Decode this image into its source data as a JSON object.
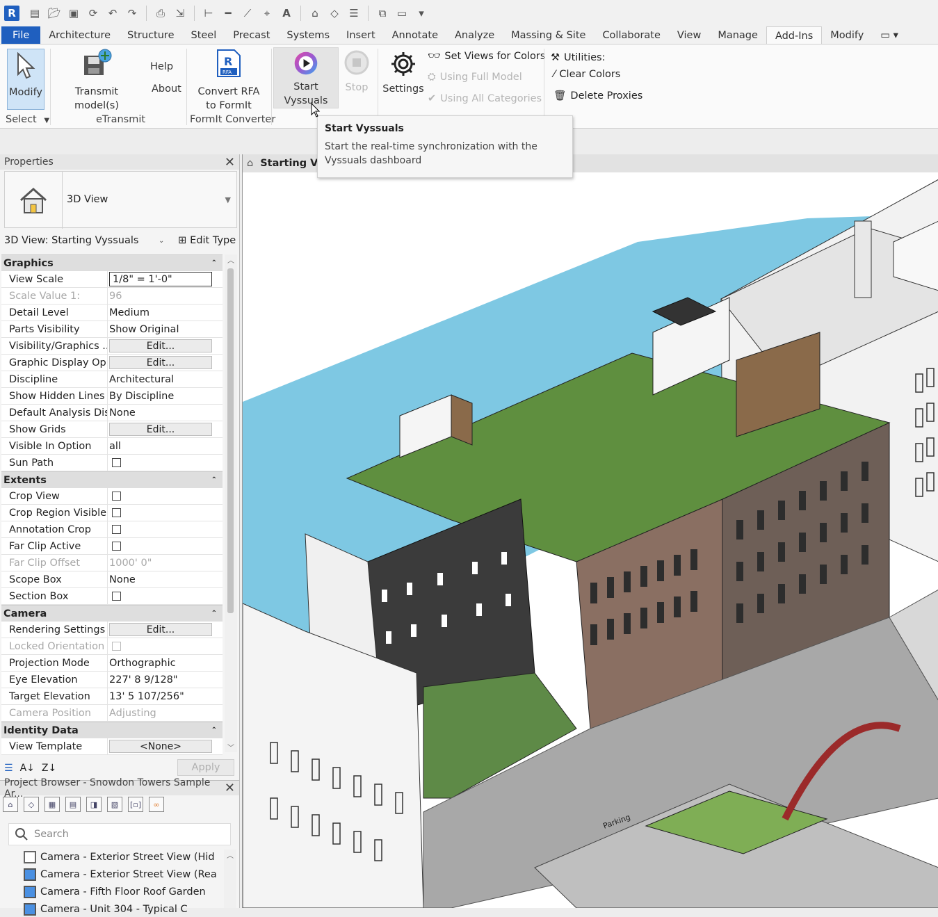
{
  "qat": {
    "logo": "R"
  },
  "tabs": [
    "File",
    "Architecture",
    "Structure",
    "Steel",
    "Precast",
    "Systems",
    "Insert",
    "Annotate",
    "Analyze",
    "Massing & Site",
    "Collaborate",
    "View",
    "Manage",
    "Add-Ins",
    "Modify"
  ],
  "ribbon": {
    "modify": "Modify",
    "select": "Select",
    "transmit": "Transmit model(s)",
    "help": "Help",
    "about": "About",
    "etransmit": "eTransmit",
    "convert_line1": "Convert RFA",
    "convert_line2": "to FormIt",
    "formit_converter": "FormIt Converter",
    "rfa_badge": "RFA",
    "start_vyssuals": "Start Vyssuals",
    "stop": "Stop",
    "settings": "Settings",
    "set_views": "Set Views for Colors",
    "using_full_model": "Using Full Model",
    "using_all_categories": "Using All Categories",
    "utilities": "Utilities:",
    "clear_colors": "Clear Colors",
    "delete_proxies": "Delete Proxies"
  },
  "tooltip": {
    "title": "Start Vyssuals",
    "body": "Start the real-time synchronization with the Vyssuals dashboard"
  },
  "properties": {
    "header": "Properties",
    "type_name": "3D View",
    "selector": "3D View: Starting Vyssuals",
    "edit_type": "Edit Type",
    "apply": "Apply",
    "sections": [
      {
        "title": "Graphics",
        "rows": [
          {
            "k": "View Scale",
            "v": "1/8\" = 1'-0\"",
            "kind": "input"
          },
          {
            "k": "Scale Value    1:",
            "v": "96",
            "kind": "gray"
          },
          {
            "k": "Detail Level",
            "v": "Medium"
          },
          {
            "k": "Parts Visibility",
            "v": "Show Original"
          },
          {
            "k": "Visibility/Graphics ...",
            "v": "Edit...",
            "kind": "btn"
          },
          {
            "k": "Graphic Display Op...",
            "v": "Edit...",
            "kind": "btn"
          },
          {
            "k": "Discipline",
            "v": "Architectural"
          },
          {
            "k": "Show Hidden Lines",
            "v": "By Discipline"
          },
          {
            "k": "Default Analysis Dis...",
            "v": "None"
          },
          {
            "k": "Show Grids",
            "v": "Edit...",
            "kind": "btn"
          },
          {
            "k": "Visible In Option",
            "v": "all"
          },
          {
            "k": "Sun Path",
            "v": "",
            "kind": "cb"
          }
        ]
      },
      {
        "title": "Extents",
        "rows": [
          {
            "k": "Crop View",
            "v": "",
            "kind": "cb"
          },
          {
            "k": "Crop Region Visible",
            "v": "",
            "kind": "cb"
          },
          {
            "k": "Annotation Crop",
            "v": "",
            "kind": "cb"
          },
          {
            "k": "Far Clip Active",
            "v": "",
            "kind": "cb"
          },
          {
            "k": "Far Clip Offset",
            "v": "1000'  0\"",
            "kind": "gray"
          },
          {
            "k": "Scope Box",
            "v": "None"
          },
          {
            "k": "Section Box",
            "v": "",
            "kind": "cb"
          }
        ]
      },
      {
        "title": "Camera",
        "rows": [
          {
            "k": "Rendering Settings",
            "v": "Edit...",
            "kind": "btn"
          },
          {
            "k": "Locked Orientation",
            "v": "",
            "kind": "graycb"
          },
          {
            "k": "Projection Mode",
            "v": "Orthographic"
          },
          {
            "k": "Eye Elevation",
            "v": "227'  8 9/128\""
          },
          {
            "k": "Target Elevation",
            "v": "13'  5 107/256\""
          },
          {
            "k": "Camera Position",
            "v": "Adjusting",
            "kind": "gray"
          }
        ]
      },
      {
        "title": "Identity Data",
        "rows": [
          {
            "k": "View Template",
            "v": "<None>",
            "kind": "btn"
          }
        ]
      }
    ]
  },
  "project_browser": {
    "header": "Project Browser - Snowdon Towers Sample Ar...",
    "search_placeholder": "Search",
    "items": [
      "Camera - Exterior Street View (Hid",
      "Camera - Exterior Street View (Rea",
      "Camera - Fifth Floor Roof Garden",
      "Camera - Unit 304 - Typical C"
    ]
  },
  "view": {
    "tab_title": "Starting Vy",
    "sign_text": "Parking"
  },
  "colors": {
    "accent": "#1f5fbf",
    "water": "#7ec8e3"
  }
}
